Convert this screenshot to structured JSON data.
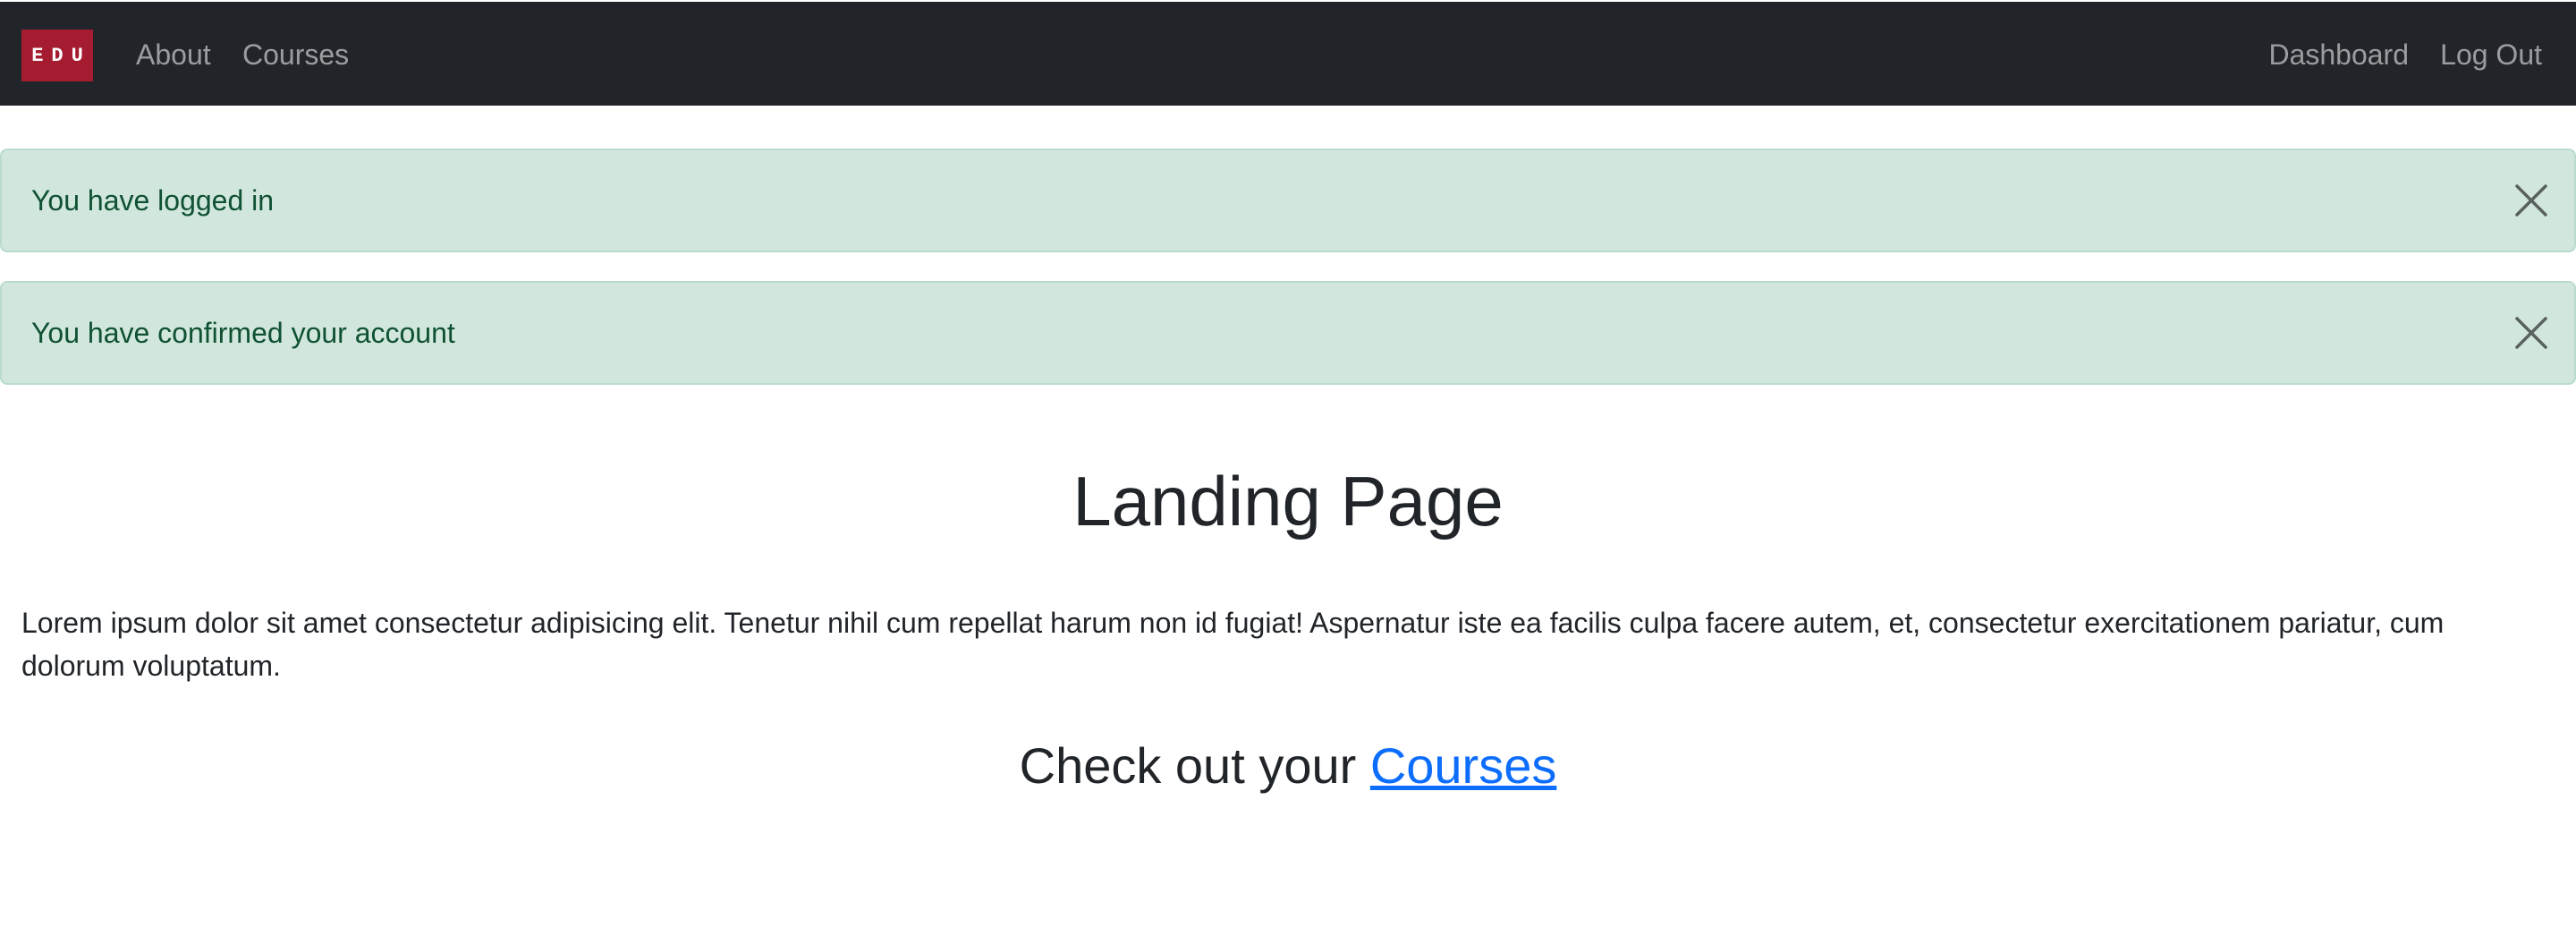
{
  "navbar": {
    "brand": "EDU",
    "left_links": [
      "About",
      "Courses"
    ],
    "right_links": [
      "Dashboard",
      "Log Out"
    ]
  },
  "alerts": [
    {
      "message": "You have logged in",
      "close_icon": "close-icon"
    },
    {
      "message": "You have confirmed your account",
      "close_icon": "close-icon"
    }
  ],
  "main": {
    "title": "Landing Page",
    "body": "Lorem ipsum dolor sit amet consectetur adipisicing elit. Tenetur nihil cum repellat harum non id fugiat! Aspernatur iste ea facilis culpa facere autem, et, consectetur exercitationem pariatur, cum dolorum voluptatum.",
    "cta_prefix": "Check out your ",
    "cta_link": "Courses"
  },
  "colors": {
    "navbar_bg": "#212529",
    "brand_bg": "#a51c30",
    "alert_bg": "#d1e7dd",
    "alert_text": "#0f5132",
    "link": "#0d6efd"
  }
}
